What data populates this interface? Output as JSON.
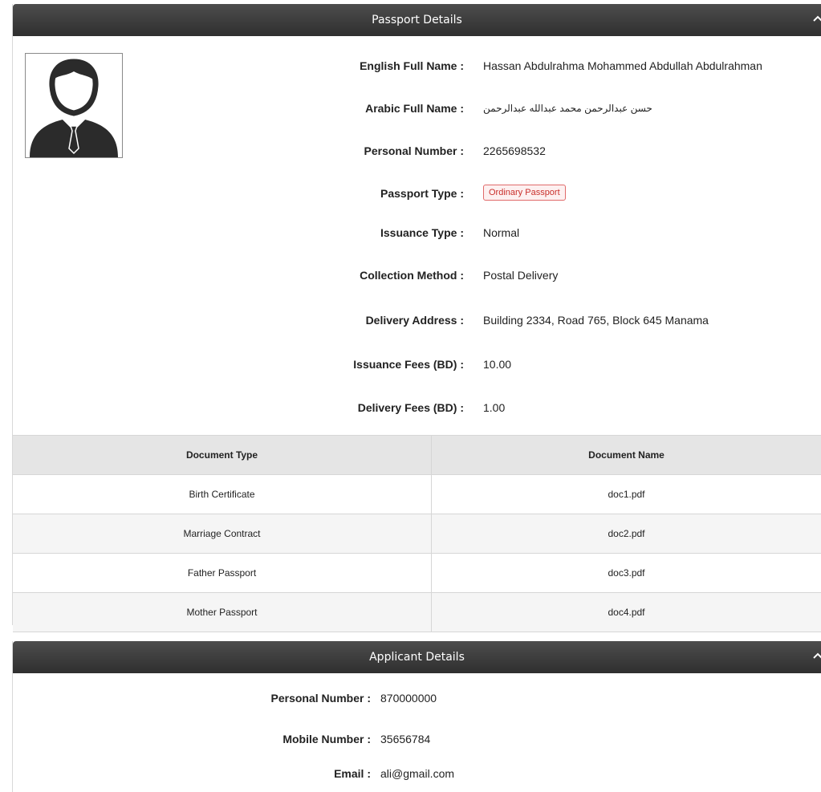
{
  "passport_panel": {
    "title": "Passport Details",
    "fields": [
      {
        "label": "English Full Name :",
        "value": "Hassan Abdulrahma Mohammed Abdullah Abdulrahman"
      },
      {
        "label": "Arabic Full Name :",
        "value": "حسن عبدالرحمن محمد عبدالله عبدالرحمن"
      },
      {
        "label": "Personal Number :",
        "value": "2265698532"
      },
      {
        "label": "Passport Type :",
        "value": "Ordinary Passport"
      },
      {
        "label": "Issuance Type :",
        "value": "Normal"
      },
      {
        "label": "Collection Method :",
        "value": "Postal Delivery"
      },
      {
        "label": "Delivery Address :",
        "value": "Building 2334, Road 765, Block 645 Manama"
      },
      {
        "label": "Issuance Fees (BD) :",
        "value": "10.00"
      },
      {
        "label": "Delivery Fees (BD) :",
        "value": "1.00"
      }
    ],
    "documents": {
      "headers": [
        "Document Type",
        "Document Name"
      ],
      "rows": [
        [
          "Birth Certificate",
          "doc1.pdf"
        ],
        [
          "Marriage Contract",
          "doc2.pdf"
        ],
        [
          "Father Passport",
          "doc3.pdf"
        ],
        [
          "Mother Passport",
          "doc4.pdf"
        ]
      ]
    }
  },
  "applicant_panel": {
    "title": "Applicant Details",
    "fields": [
      {
        "label": "Personal Number :",
        "value": "870000000"
      },
      {
        "label": "Mobile Number :",
        "value": "35656784"
      },
      {
        "label": "Email :",
        "value": "ali@gmail.com"
      }
    ]
  },
  "icons": {
    "avatar": "user-avatar-icon",
    "collapse": "chevron-up-icon"
  },
  "colors": {
    "header_bg": "#3a3a3a",
    "badge_red": "#c9302c"
  }
}
